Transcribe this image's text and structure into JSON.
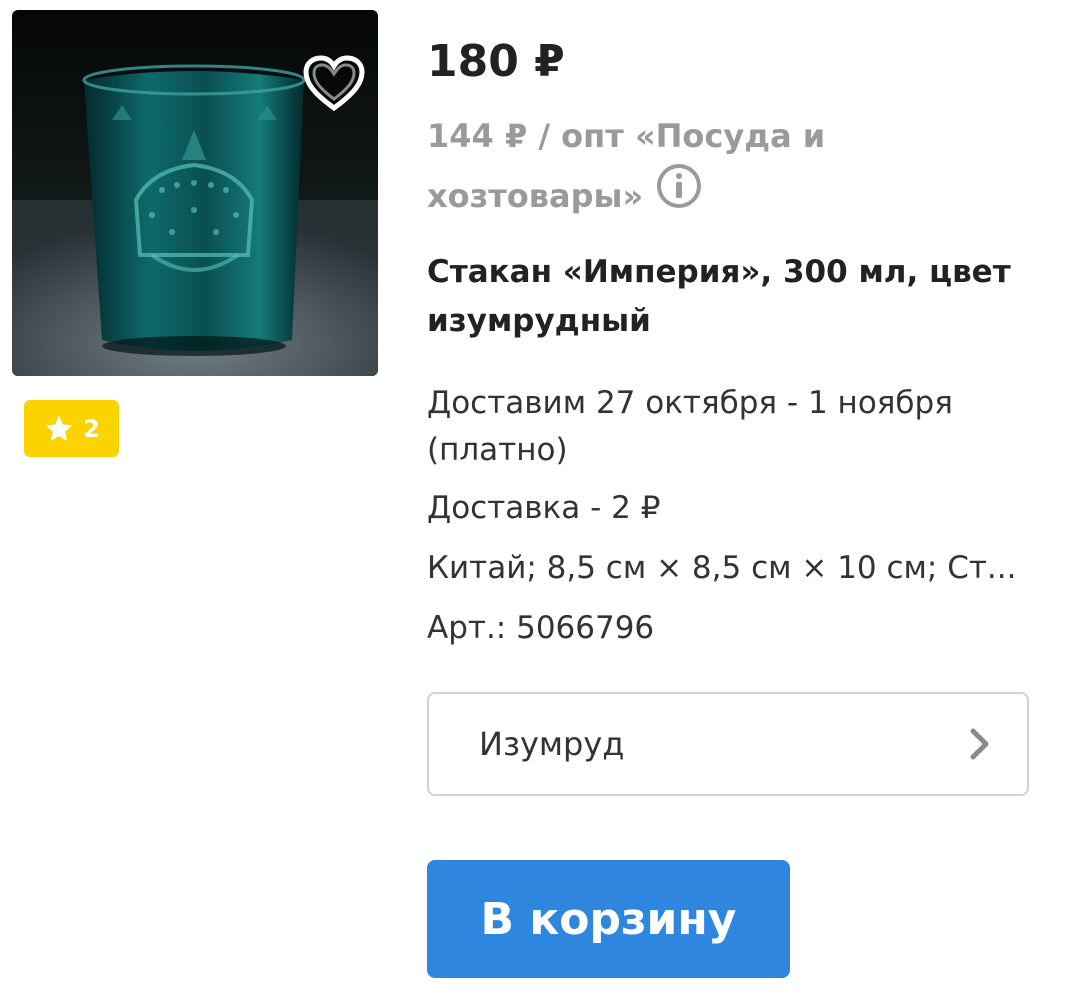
{
  "product": {
    "price": "180 ₽",
    "wholesale_note": "144 ₽ / опт «Посуда и хозтовары»",
    "title": "Стакан «Империя», 300 мл, цвет изумрудный",
    "delivery_dates": "Доставим 27 октября - 1 ноября (платно)",
    "delivery_cost": "Доставка - 2 ₽",
    "specs": "Китай; 8,5 см × 8,5 см × 10 см; Ст...",
    "article": "Арт.: 5066796",
    "rating_count": "2",
    "variant": "Изумруд",
    "cart_button_label": "В корзину"
  },
  "icons": {
    "favorite": "heart-icon",
    "info": "info-icon",
    "rating": "star-icon",
    "variant_arrow": "chevron-right-icon"
  },
  "colors": {
    "accent": "#2e86de",
    "rating_badge": "#fbd400",
    "muted_text": "#9a9a9a",
    "glass": "#0f5a5a"
  }
}
